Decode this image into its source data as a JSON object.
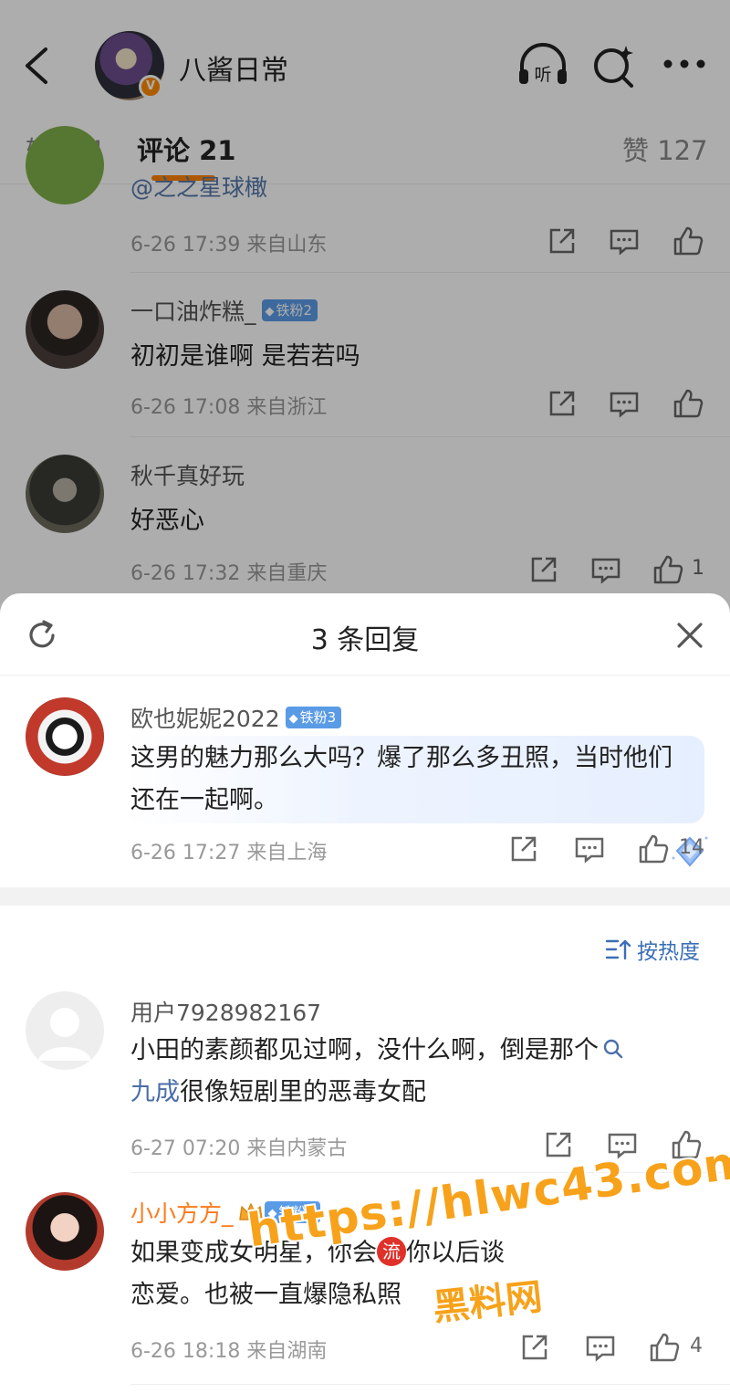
{
  "header": {
    "title": "八酱日常",
    "verified_badge": "V",
    "icons": [
      "back-icon",
      "listen-icon",
      "search-spark-icon",
      "more-icon"
    ],
    "listen_label": "听"
  },
  "tabs": {
    "repost": "转发 4",
    "comments": "评论 21",
    "likes": "赞 127"
  },
  "bg_comments": [
    {
      "name": "",
      "partial_text": "@之之星球橄",
      "meta": "6-26 17:39 来自山东",
      "like_count": ""
    },
    {
      "name": "一口油炸糕_",
      "fan_badge": "铁粉2",
      "text": "初初是谁啊  是若若吗",
      "meta": "6-26 17:08 来自浙江",
      "like_count": ""
    },
    {
      "name": "秋千真好玩",
      "text": "好恶心",
      "meta": "6-26 17:32 来自重庆",
      "like_count": "1"
    }
  ],
  "sheet": {
    "title": "3 条回复",
    "main_comment": {
      "name": "欧也妮妮2022",
      "fan_badge": "铁粉3",
      "text": "这男的魅力那么大吗？爆了那么多丑照，当时他们还在一起啊。",
      "meta": "6-26 17:27 来自上海",
      "like_count": "14"
    },
    "sort_label": "按热度",
    "replies": [
      {
        "name": "用户7928982167",
        "text_before": "小田的素颜都见过啊，没什么啊，倒是那个",
        "link_word": "九成",
        "text_after": "很像短剧里的恶毒女配",
        "meta": "6-27 07:20 来自内蒙古",
        "like_count": ""
      },
      {
        "name": "小小方方_",
        "fan_badge": "铁粉1",
        "text_line1_a": "如果变成女明星，你会",
        "chip": "流",
        "text_line1_b": "你以后谈",
        "text_line2": "恋爱。也被一直爆隐私照",
        "meta": "6-26 18:18 来自湖南",
        "like_count": "4"
      }
    ]
  },
  "watermark": {
    "line1": "https://hlwc43.com",
    "line2": "黑料网"
  },
  "colors": {
    "accent": "#ff8200",
    "fan_badge": "#5a9be6",
    "link": "#3b6fb6"
  }
}
